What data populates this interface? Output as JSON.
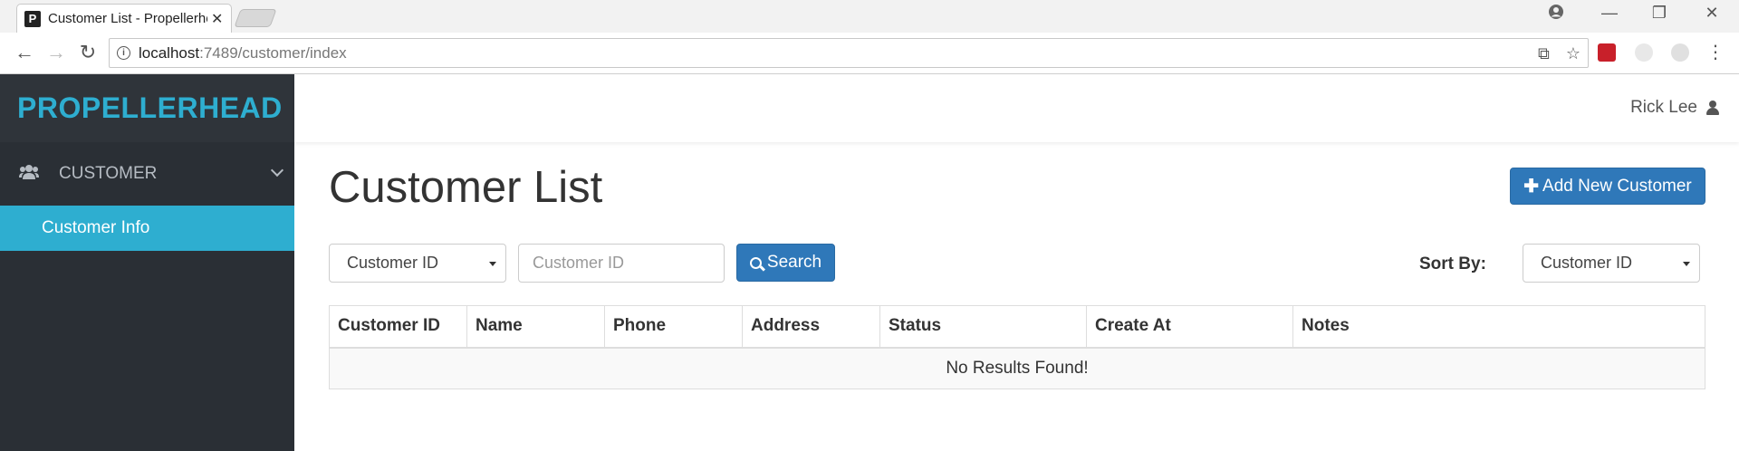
{
  "browser": {
    "tab_title": "Customer List - Propellerhead",
    "favicon_letter": "P",
    "url_host": "localhost",
    "url_path": ":7489/customer/index"
  },
  "sidebar": {
    "brand": "PROPELLERHEAD",
    "group_label": "CUSTOMER",
    "items": [
      {
        "label": "Customer Info",
        "active": true
      }
    ],
    "colors": {
      "accent": "#2eaed0",
      "bg": "#2a2f35"
    }
  },
  "topbar": {
    "user_name": "Rick Lee"
  },
  "main": {
    "title": "Customer List",
    "add_button": "Add New Customer",
    "filter_select": "Customer ID",
    "filter_input_placeholder": "Customer ID",
    "search_button": "Search",
    "sort_label": "Sort By:",
    "sort_select": "Customer ID",
    "table": {
      "columns": [
        "Customer ID",
        "Name",
        "Phone",
        "Address",
        "Status",
        "Create At",
        "Notes"
      ],
      "empty_message": "No Results Found!"
    },
    "colors": {
      "primary": "#2f78b9"
    }
  }
}
